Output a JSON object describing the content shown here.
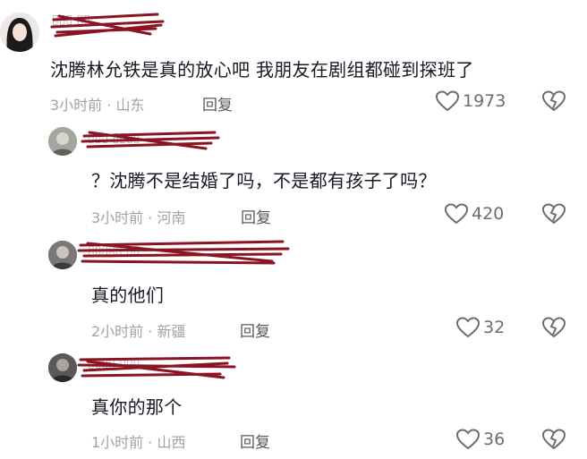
{
  "comments": [
    {
      "text": "沈腾林允铁是真的放心吧 我朋友在剧组都碰到探班了",
      "time": "3小时前",
      "location": "山东",
      "reply_label": "回复",
      "likes": "1973"
    },
    {
      "text": "？沈腾不是结婚了吗，不是都有孩子了吗？",
      "time": "3小时前",
      "location": "河南",
      "reply_label": "回复",
      "likes": "420"
    },
    {
      "text": "真的他们",
      "time": "2小时前",
      "location": "新疆",
      "reply_label": "回复",
      "likes": "32"
    },
    {
      "text": "真你的那个",
      "time": "1小时前",
      "location": "山西",
      "reply_label": "回复",
      "likes": "36"
    }
  ],
  "meta_separator": "·",
  "icons": {
    "like": "heart-outline-icon",
    "dislike": "broken-heart-icon"
  },
  "colors": {
    "scribble": "#8b1423",
    "meta": "#a1a2a6",
    "text": "#161823"
  }
}
